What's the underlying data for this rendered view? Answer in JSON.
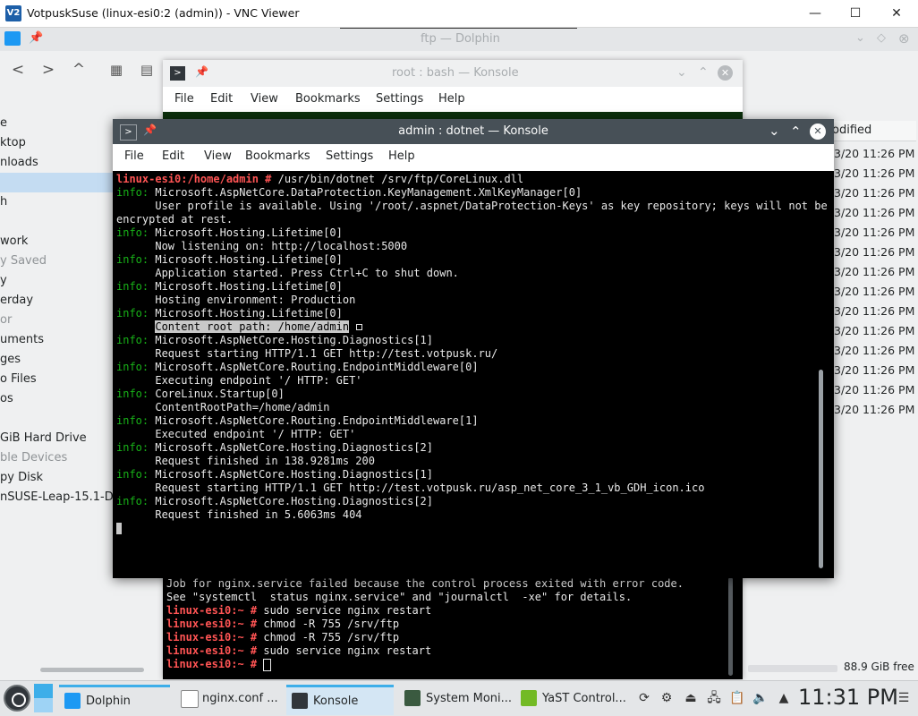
{
  "vnc": {
    "title": "VotpuskSuse (linux-esi0:2 (admin)) - VNC Viewer",
    "logo": "V2",
    "minimize": "—",
    "maximize": "☐",
    "close": "✕"
  },
  "dolphin": {
    "title": "ftp — Dolphin",
    "places": [
      {
        "label": "e",
        "type": "item"
      },
      {
        "label": "ktop",
        "type": "item"
      },
      {
        "label": "nloads",
        "type": "item"
      },
      {
        "label": "",
        "type": "selected"
      },
      {
        "label": "h",
        "type": "item"
      },
      {
        "label": "",
        "type": "spacer"
      },
      {
        "label": "work",
        "type": "item"
      },
      {
        "label": "y Saved",
        "type": "header"
      },
      {
        "label": "y",
        "type": "item"
      },
      {
        "label": "erday",
        "type": "item"
      },
      {
        "label": "or",
        "type": "header"
      },
      {
        "label": "uments",
        "type": "item"
      },
      {
        "label": "ges",
        "type": "item"
      },
      {
        "label": "o Files",
        "type": "item"
      },
      {
        "label": "os",
        "type": "item"
      },
      {
        "label": "",
        "type": "spacer"
      },
      {
        "label": "GiB Hard Drive",
        "type": "item"
      },
      {
        "label": "ble Devices",
        "type": "header"
      },
      {
        "label": "py Disk",
        "type": "item"
      },
      {
        "label": "nSUSE-Leap-15.1-DVD",
        "type": "item"
      }
    ],
    "column_modified": "odified",
    "modified_values": [
      "3/20 11:26 PM",
      "3/20 11:26 PM",
      "3/20 11:26 PM",
      "3/20 11:26 PM",
      "3/20 11:26 PM",
      "3/20 11:26 PM",
      "3/20 11:26 PM",
      "3/20 11:26 PM",
      "3/20 11:26 PM",
      "3/20 11:26 PM",
      "3/20 11:26 PM",
      "3/20 11:26 PM",
      "3/20 11:26 PM",
      "3/20 11:26 PM"
    ],
    "free_space": "88.9 GiB free"
  },
  "konsole_back": {
    "title": "root : bash — Konsole",
    "menu": [
      "File",
      "Edit",
      "View",
      "Bookmarks",
      "Settings",
      "Help"
    ],
    "lines": [
      {
        "prompt": "",
        "text": "Job for nginx.service failed because the control process exited with error code."
      },
      {
        "prompt": "",
        "text": "See \"systemctl  status nginx.service\" and \"journalctl  -xe\" for details."
      },
      {
        "prompt": "linux-esi0:~ #",
        "text": " sudo service nginx restart"
      },
      {
        "prompt": "linux-esi0:~ #",
        "text": " chmod -R 755 /srv/ftp"
      },
      {
        "prompt": "linux-esi0:~ #",
        "text": " chmod -R 755 /srv/ftp"
      },
      {
        "prompt": "linux-esi0:~ #",
        "text": " sudo service nginx restart"
      },
      {
        "prompt": "linux-esi0:~ #",
        "text": " "
      }
    ]
  },
  "konsole_front": {
    "title": "admin : dotnet — Konsole",
    "menu": [
      "File",
      "Edit",
      "View",
      "Bookmarks",
      "Settings",
      "Help"
    ],
    "prompt": "linux-esi0:/home/admin #",
    "command": " /usr/bin/dotnet /srv/ftp/CoreLinux.dll",
    "lines": [
      {
        "tag": "info:",
        "text": " Microsoft.AspNetCore.DataProtection.KeyManagement.XmlKeyManager[0]"
      },
      {
        "tag": "",
        "text": "      User profile is available. Using '/root/.aspnet/DataProtection-Keys' as key repository; keys will not be"
      },
      {
        "tag": "",
        "text": "encrypted at rest."
      },
      {
        "tag": "info:",
        "text": " Microsoft.Hosting.Lifetime[0]"
      },
      {
        "tag": "",
        "text": "      Now listening on: http://localhost:5000"
      },
      {
        "tag": "info:",
        "text": " Microsoft.Hosting.Lifetime[0]"
      },
      {
        "tag": "",
        "text": "      Application started. Press Ctrl+C to shut down."
      },
      {
        "tag": "info:",
        "text": " Microsoft.Hosting.Lifetime[0]"
      },
      {
        "tag": "",
        "text": "      Hosting environment: Production"
      },
      {
        "tag": "info:",
        "text": " Microsoft.Hosting.Lifetime[0]"
      },
      {
        "tag": "",
        "text": "      ",
        "highlight": "Content root path: /home/admin"
      },
      {
        "tag": "info:",
        "text": " Microsoft.AspNetCore.Hosting.Diagnostics[1]"
      },
      {
        "tag": "",
        "text": "      Request starting HTTP/1.1 GET http://test.votpusk.ru/"
      },
      {
        "tag": "info:",
        "text": " Microsoft.AspNetCore.Routing.EndpointMiddleware[0]"
      },
      {
        "tag": "",
        "text": "      Executing endpoint '/ HTTP: GET'"
      },
      {
        "tag": "info:",
        "text": " CoreLinux.Startup[0]"
      },
      {
        "tag": "",
        "text": "      ContentRootPath=/home/admin"
      },
      {
        "tag": "info:",
        "text": " Microsoft.AspNetCore.Routing.EndpointMiddleware[1]"
      },
      {
        "tag": "",
        "text": "      Executed endpoint '/ HTTP: GET'"
      },
      {
        "tag": "info:",
        "text": " Microsoft.AspNetCore.Hosting.Diagnostics[2]"
      },
      {
        "tag": "",
        "text": "      Request finished in 138.9281ms 200"
      },
      {
        "tag": "info:",
        "text": " Microsoft.AspNetCore.Hosting.Diagnostics[1]"
      },
      {
        "tag": "",
        "text": "      Request starting HTTP/1.1 GET http://test.votpusk.ru/asp_net_core_3_1_vb_GDH_icon.ico"
      },
      {
        "tag": "info:",
        "text": " Microsoft.AspNetCore.Hosting.Diagnostics[2]"
      },
      {
        "tag": "",
        "text": "      Request finished in 5.6063ms 404"
      }
    ]
  },
  "taskbar": {
    "tasks": [
      {
        "label": "Dolphin",
        "icon": "folder-icon",
        "color": "#1d99f3"
      },
      {
        "label": "nginx.conf ...",
        "icon": "text-file-icon",
        "color": "#ffffff"
      },
      {
        "label": "Konsole",
        "icon": "terminal-icon",
        "color": "#31363b"
      },
      {
        "label": "System Moni...",
        "icon": "system-monitor-icon",
        "color": "#3a5a40"
      },
      {
        "label": "YaST Control...",
        "icon": "yast-icon",
        "color": "#73ba25"
      }
    ],
    "clock": "11:31 PM"
  }
}
